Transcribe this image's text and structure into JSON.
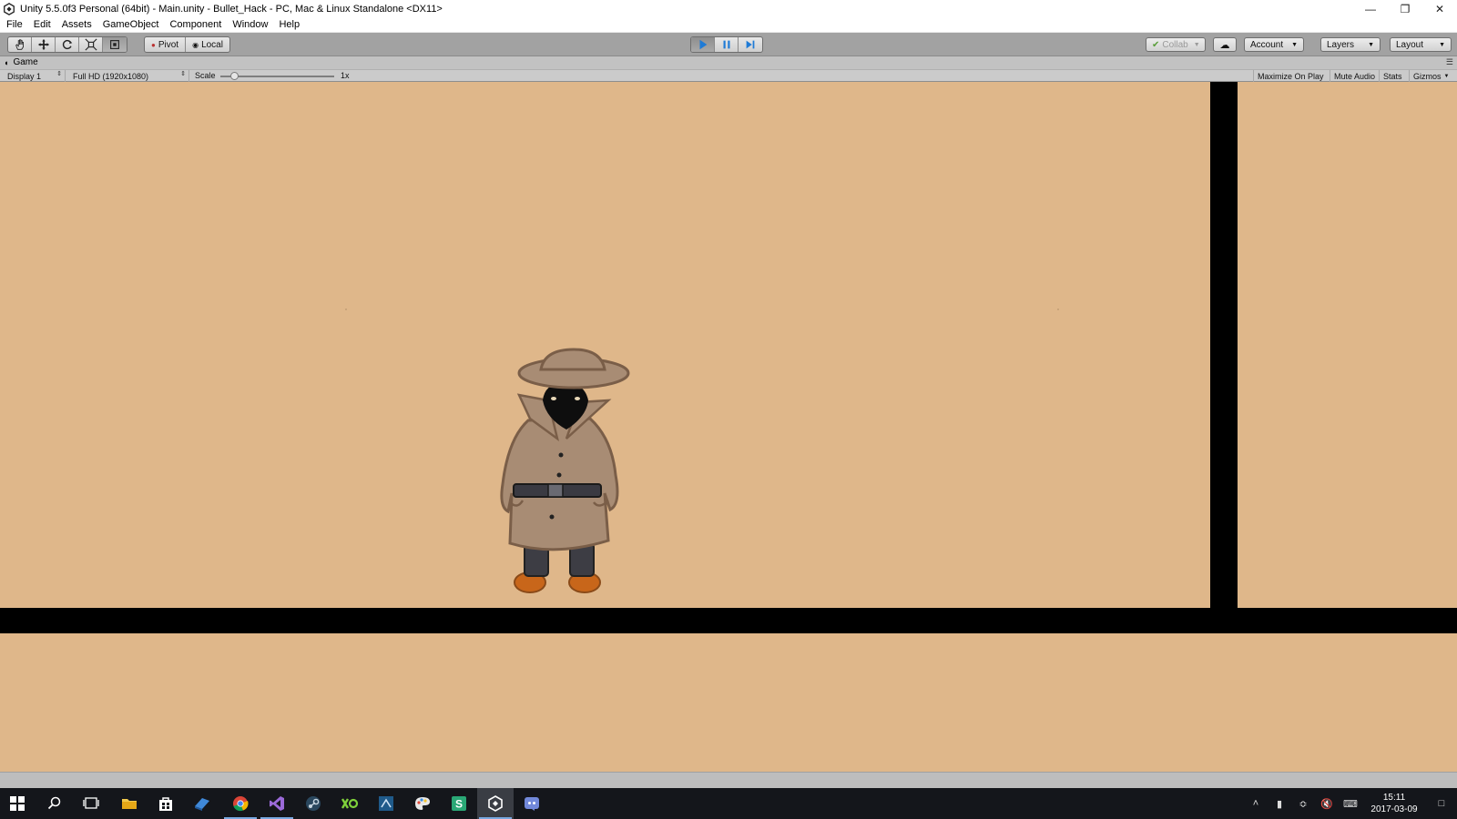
{
  "window": {
    "title": "Unity 5.5.0f3 Personal (64bit) - Main.unity - Bullet_Hack - PC, Mac & Linux Standalone <DX11>",
    "minimize": "—",
    "maximize": "❐",
    "close": "✕"
  },
  "menu": [
    "File",
    "Edit",
    "Assets",
    "GameObject",
    "Component",
    "Window",
    "Help"
  ],
  "toolbar": {
    "tools": [
      "hand-tool",
      "move-tool",
      "rotate-tool",
      "scale-tool",
      "rect-tool"
    ],
    "active_tool": "rect-tool",
    "pivot_label": "Pivot",
    "local_label": "Local",
    "play_state": "playing",
    "collab_label": "Collab",
    "account_label": "Account",
    "layers_label": "Layers",
    "layout_label": "Layout"
  },
  "game_panel": {
    "tab_label": "Game",
    "display": "Display 1",
    "resolution": "Full HD (1920x1080)",
    "scale_label": "Scale",
    "scale_value": "1x",
    "scale_fraction": 0.08,
    "maximize_on_play": "Maximize On Play",
    "mute_audio": "Mute Audio",
    "stats": "Stats",
    "gizmos": "Gizmos"
  },
  "scene": {
    "background_color": "#dfb78a",
    "wall_color": "#000000",
    "character": "trench-coat-detective"
  },
  "taskbar": {
    "apps": [
      "file-explorer",
      "store",
      "app-blue",
      "chrome",
      "visual-studio",
      "steam",
      "app-green",
      "app-navy",
      "paint",
      "app-s",
      "unity",
      "discord"
    ],
    "time": "15:11",
    "date": "2017-03-09"
  }
}
